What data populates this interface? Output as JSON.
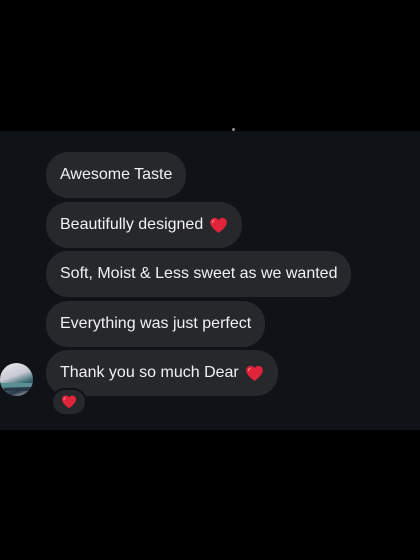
{
  "chat": {
    "messages": [
      {
        "text": "Awesome Taste"
      },
      {
        "text": "Beautifully designed"
      },
      {
        "text": "Soft, Moist & Less sweet as we wanted"
      },
      {
        "text": "Everything was just perfect"
      },
      {
        "text": "Thank you so much Dear"
      }
    ],
    "reaction_icon": "red-heart-icon",
    "colors": {
      "background": "#000000",
      "panel": "#0f1216",
      "bubble": "#26282c",
      "text": "#f2f2f2",
      "heart": "#e0243a"
    }
  }
}
